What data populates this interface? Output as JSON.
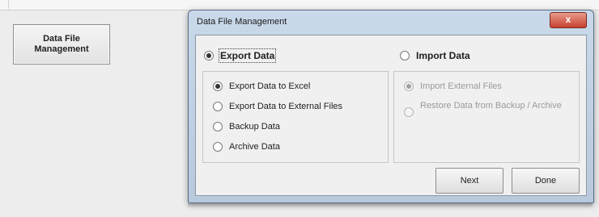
{
  "launcher": {
    "label": "Data File\nManagement"
  },
  "dialog": {
    "title": "Data File Management",
    "close_label": "x",
    "mode_export_label": "Export Data",
    "mode_import_label": "Import Data",
    "export_options": [
      {
        "label": "Export Data to Excel",
        "checked": true
      },
      {
        "label": "Export Data to External Files",
        "checked": false
      },
      {
        "label": "Backup Data",
        "checked": false
      },
      {
        "label": "Archive Data",
        "checked": false
      }
    ],
    "import_options": [
      {
        "label": "Import External Files",
        "checked": true
      },
      {
        "label": "Restore Data from Backup / Archive",
        "checked": false
      }
    ],
    "next_label": "Next",
    "done_label": "Done"
  },
  "colors": {
    "title_bar": "#c0d2e5",
    "close": "#c8412e",
    "client": "#f0f0f0"
  }
}
